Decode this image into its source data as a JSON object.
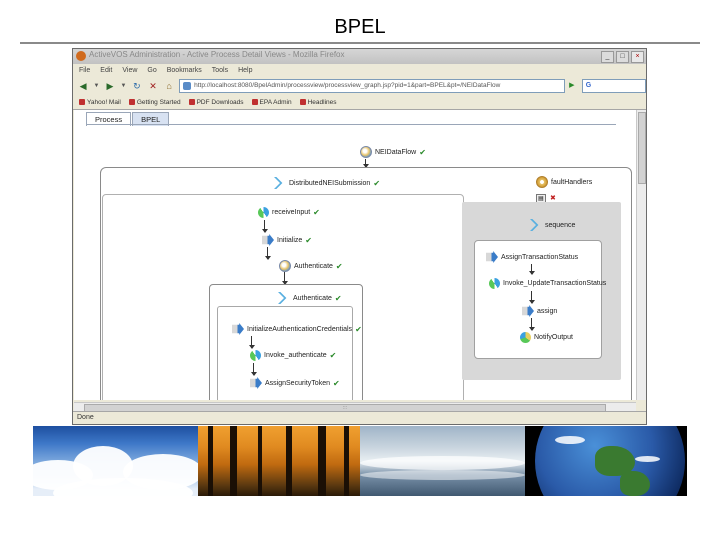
{
  "slide": {
    "title": "BPEL"
  },
  "browser": {
    "window_title": "ActiveVOS Administration - Active Process Detail Views - Mozilla Firefox",
    "menu": [
      "File",
      "Edit",
      "View",
      "Go",
      "Bookmarks",
      "Tools",
      "Help"
    ],
    "url": "http://localhost:8080/BpelAdmin/processview/processview_graph.jsp?pid=1&part=BPEL&pt=/NEIDataFlow",
    "search_placeholder": "",
    "bookmarks": [
      "Yahoo! Mail",
      "Getting Started",
      "PDF Downloads",
      "EPA Admin",
      "Headlines"
    ],
    "status": "Done"
  },
  "tabs": [
    {
      "label": "Process",
      "active": true
    },
    {
      "label": "BPEL",
      "active": false
    }
  ],
  "diagram": {
    "root": "NEIDataFlow",
    "main_sequence": "DistributedNEISubmission",
    "steps": [
      "receiveInput",
      "Initialize",
      "Authenticate"
    ],
    "sub_sequence": "Authenticate",
    "sub_steps": [
      "InitializeAuthenticationCredentials",
      "Invoke_authenticate",
      "AssignSecurityToken"
    ],
    "fault_handlers": "faultHandlers",
    "fault_sequence": "sequence",
    "fault_steps": [
      "AssignTransactionStatus",
      "Invoke_UpdateTransactionStatus",
      "assign",
      "NotifyOutput"
    ],
    "check_mark": "✔",
    "colors": {
      "tab_active": "#ffffff",
      "tab_inactive": "#d8e2f2",
      "fault_area": "#d8d8d8",
      "check": "#2a8a2a"
    }
  },
  "photos": [
    "sky-clouds",
    "forest-sunset",
    "ocean-waves",
    "earth-globe"
  ]
}
